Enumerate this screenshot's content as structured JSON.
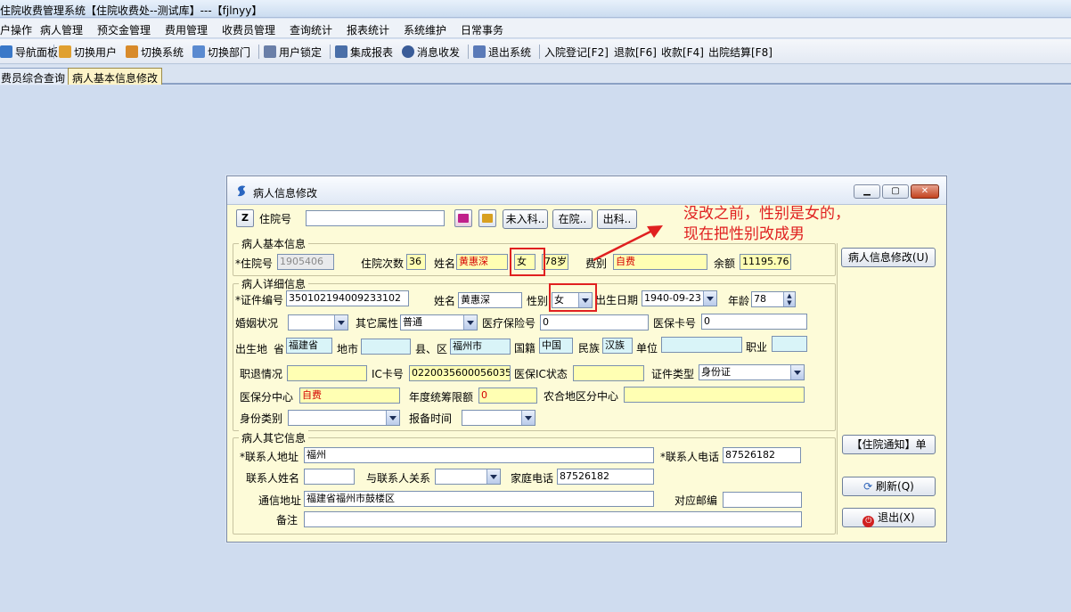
{
  "app": {
    "title": "住院收费管理系统【住院收费处--测试库】---【fjlnyy】"
  },
  "menu": [
    "户操作",
    "病人管理",
    "预交金管理",
    "费用管理",
    "收费员管理",
    "查询统计",
    "报表统计",
    "系统维护",
    "日常事务"
  ],
  "toolbar": {
    "nav": "导航面板",
    "switch_user": "切换用户",
    "switch_system": "切换系统",
    "switch_dept": "切换部门",
    "user_lock": "用户锁定",
    "report": "集成报表",
    "message": "消息收发",
    "exit": "退出系统",
    "admit": "入院登记[F2]",
    "refund": "退款[F6]",
    "charge": "收款[F4]",
    "discharge": "出院结算[F8]"
  },
  "tabs": [
    "费员综合查询",
    "病人基本信息修改"
  ],
  "dialog": {
    "title": "病人信息修改",
    "top": {
      "z_label": "Z",
      "hosp_no_label": "住院号",
      "hosp_no_value": "",
      "btn_not_admitted": "未入科..",
      "btn_in_hosp": "在院..",
      "btn_out_dept": "出科.."
    },
    "basic": {
      "group_title": "病人基本信息",
      "hosp_no_label": "*住院号",
      "hosp_no": "1905406",
      "visits_label": "住院次数",
      "visits": "36",
      "name_label": "姓名",
      "name": "黄惠深",
      "sex": "女",
      "age": "78岁",
      "fee_type_label": "费别",
      "fee_type": "自费",
      "balance_label": "余额",
      "balance": "11195.76"
    },
    "detail": {
      "group_title": "病人详细信息",
      "id_no_label": "*证件编号",
      "id_no": "350102194009233102",
      "name_label": "姓名",
      "name": "黄惠深",
      "sex_label": "性别",
      "sex": "女",
      "birth_label": "出生日期",
      "birth": "1940-09-23",
      "age_label": "年龄",
      "age": "78",
      "marital_label": "婚姻状况",
      "marital": "",
      "other_attr_label": "其它属性",
      "other_attr": "普通",
      "insurance_no_label": "医疗保险号",
      "insurance_no": "0",
      "insurance_card_label": "医保卡号",
      "insurance_card": "0",
      "birthplace_label": "出生地",
      "province_label": "省",
      "province": "福建省",
      "city_label": "地市",
      "city": "",
      "county_label": "县、区",
      "county": "福州市",
      "nationality_label": "国籍",
      "nationality": "中国",
      "ethnic_label": "民族",
      "ethnic": "汉族",
      "employer_label": "单位",
      "employer": "",
      "occupation_label": "职业",
      "occupation": "",
      "retire_label": "职退情况",
      "retire": "",
      "ic_label": "IC卡号",
      "ic": "0220035600056035",
      "ic_status_label": "医保IC状态",
      "ic_status": "",
      "id_type_label": "证件类型",
      "id_type": "身份证",
      "center_label": "医保分中心",
      "center": "自费",
      "annual_label": "年度统筹限额",
      "annual": "0",
      "rural_label": "农合地区分中心",
      "rural": "",
      "identity_label": "身份类别",
      "identity": "",
      "report_time_label": "报备时间",
      "report_time": ""
    },
    "other": {
      "group_title": "病人其它信息",
      "contact_addr_label": "*联系人地址",
      "contact_addr": "福州",
      "contact_tel_label": "*联系人电话",
      "contact_tel": "87526182",
      "contact_name_label": "联系人姓名",
      "contact_name": "",
      "relation_label": "与联系人关系",
      "relation": "",
      "home_tel_label": "家庭电话",
      "home_tel": "87526182",
      "mail_addr_label": "通信地址",
      "mail_addr": "福建省福州市鼓楼区",
      "zip_label": "对应邮编",
      "zip": "",
      "note_label": "备注",
      "note": ""
    },
    "side": {
      "modify": "病人信息修改(U)",
      "notice": "【住院通知】单",
      "refresh": "刷新(Q)",
      "exit": "退出(X)"
    }
  },
  "annotation": {
    "line1": "没改之前，性别是女的，",
    "line2": "现在把性别改成男"
  },
  "colors": {
    "highlight_red": "#e02020",
    "field_yellow": "#ffffb3",
    "dialog_bg": "#fdfbd8"
  }
}
